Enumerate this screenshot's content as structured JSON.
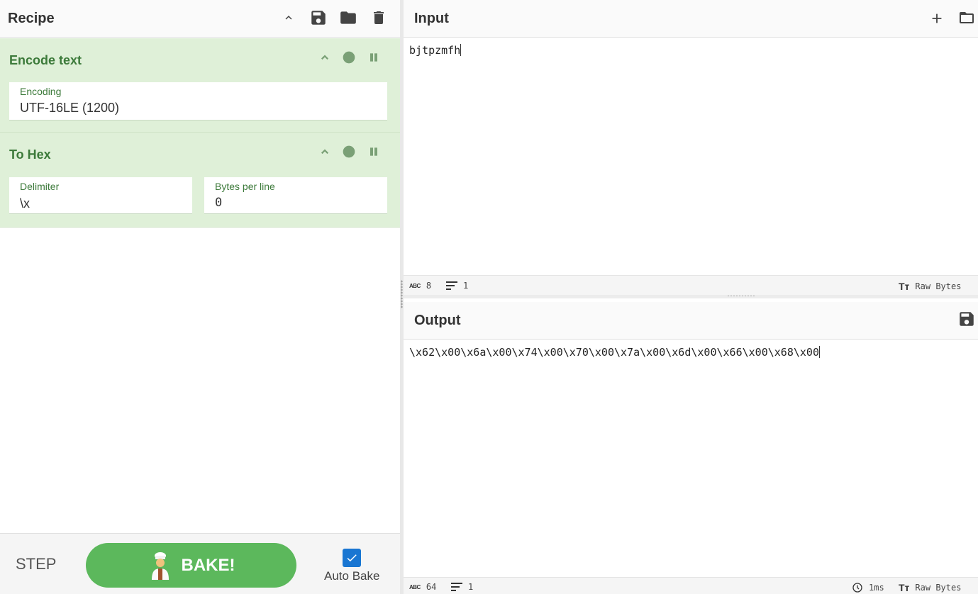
{
  "recipe": {
    "title": "Recipe",
    "icons": [
      "chevron-up-icon",
      "save-icon",
      "folder-icon",
      "trash-icon"
    ],
    "operations": [
      {
        "name": "Encode text",
        "fields": [
          {
            "label": "Encoding",
            "value": "UTF-16LE (1200)"
          }
        ]
      },
      {
        "name": "To Hex",
        "fields": [
          {
            "label": "Delimiter",
            "value": "\\x"
          },
          {
            "label": "Bytes per line",
            "value": "0"
          }
        ]
      }
    ]
  },
  "controls": {
    "step_label": "STEP",
    "bake_label": "BAKE!",
    "auto_bake_label": "Auto Bake",
    "auto_bake_checked": true
  },
  "input": {
    "title": "Input",
    "text": "bjtpzmfh",
    "status": {
      "length": "8",
      "lines": "1",
      "encoding": "Raw Bytes"
    }
  },
  "output": {
    "title": "Output",
    "text": "\\x62\\x00\\x6a\\x00\\x74\\x00\\x70\\x00\\x7a\\x00\\x6d\\x00\\x66\\x00\\x68\\x00",
    "status": {
      "length": "64",
      "lines": "1",
      "time": "1ms",
      "encoding": "Raw Bytes"
    }
  },
  "colors": {
    "op_background": "#dff0d8",
    "op_title": "#3c7a3a",
    "bake_button": "#5cb85c",
    "checkbox": "#1976d2"
  }
}
